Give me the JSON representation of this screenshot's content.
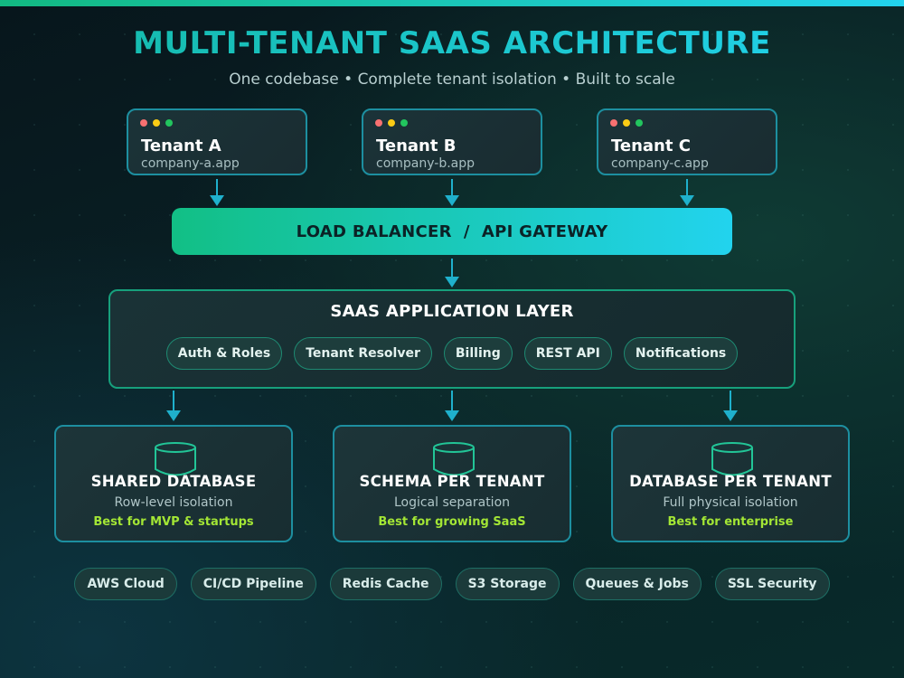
{
  "title": "MULTI-TENANT SAAS ARCHITECTURE",
  "subtitle": "One codebase • Complete tenant isolation • Built to scale",
  "colors": {
    "accent_green": "#12b981",
    "accent_cyan": "#22d3ee",
    "highlight_lime": "#a3e635",
    "window_lights": [
      "#f87171",
      "#facc15",
      "#22c55e"
    ]
  },
  "tenants": [
    {
      "name": "Tenant A",
      "domain": "company-a.app"
    },
    {
      "name": "Tenant B",
      "domain": "company-b.app"
    },
    {
      "name": "Tenant C",
      "domain": "company-c.app"
    }
  ],
  "gateway": {
    "label": "LOAD BALANCER  /  API GATEWAY"
  },
  "app_layer": {
    "title": "SAAS APPLICATION LAYER",
    "modules": [
      "Auth & Roles",
      "Tenant Resolver",
      "Billing",
      "REST API",
      "Notifications"
    ]
  },
  "databases": [
    {
      "icon": "database-icon",
      "name": "SHARED DATABASE",
      "description": "Row-level isolation",
      "best_for": "Best for MVP & startups"
    },
    {
      "icon": "database-icon",
      "name": "SCHEMA PER TENANT",
      "description": "Logical separation",
      "best_for": "Best for growing SaaS"
    },
    {
      "icon": "database-icon",
      "name": "DATABASE PER TENANT",
      "description": "Full physical isolation",
      "best_for": "Best for enterprise"
    }
  ],
  "infrastructure": [
    "AWS Cloud",
    "CI/CD Pipeline",
    "Redis Cache",
    "S3 Storage",
    "Queues & Jobs",
    "SSL Security"
  ]
}
